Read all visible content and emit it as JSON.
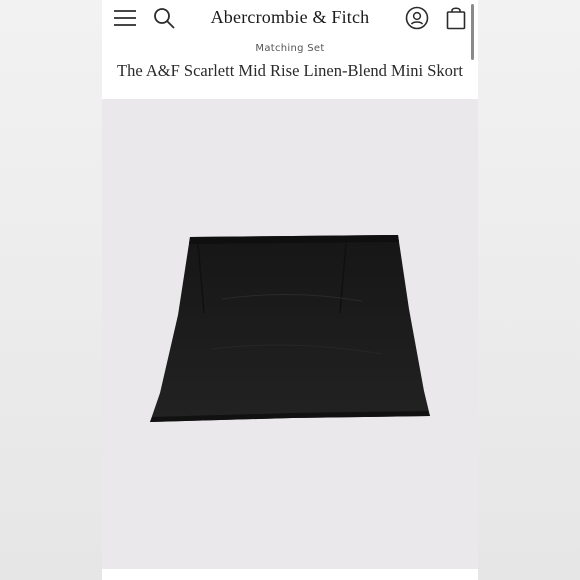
{
  "header": {
    "brand": "Abercrombie & Fitch",
    "icons": {
      "menu": "hamburger-menu-icon",
      "search": "search-icon",
      "account": "account-icon",
      "bag": "shopping-bag-icon"
    }
  },
  "product": {
    "collection": "Matching Set",
    "title": "The A&F Scarlett Mid Rise Linen-Blend Mini Skort",
    "image_alt": "black mini skort"
  },
  "colors": {
    "page_bg": "#ffffff",
    "image_bg": "#eae8ea",
    "skirt": "#1c1c1c"
  }
}
